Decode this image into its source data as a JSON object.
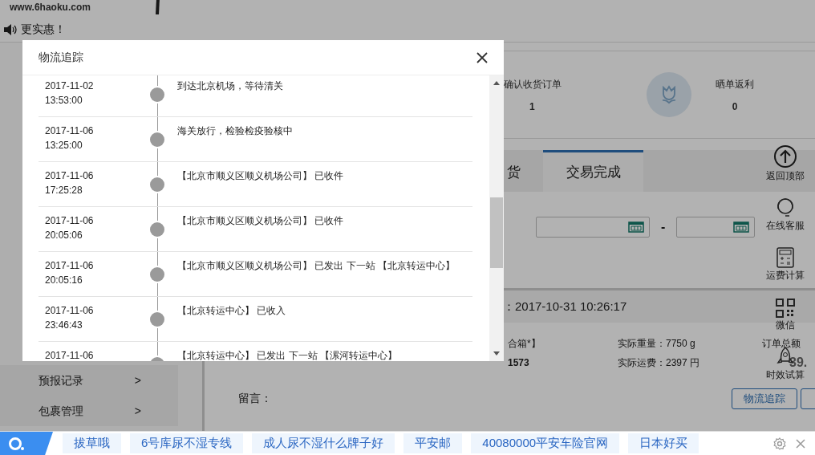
{
  "site": {
    "logo": "www.6haoku.com"
  },
  "notice": {
    "text": "更实惠！"
  },
  "sidebar": {
    "items": [
      {
        "label": "预报记录",
        "arrow": ">"
      },
      {
        "label": "包裹管理",
        "arrow": ">"
      }
    ]
  },
  "stats": [
    {
      "label": "确认收货订单",
      "value": "1"
    },
    {
      "label": "晒单返利",
      "value": "0"
    }
  ],
  "tabs": [
    {
      "label": "货",
      "selected": false
    },
    {
      "label": "交易完成",
      "selected": true
    }
  ],
  "filter": {
    "separator": "-"
  },
  "order": {
    "time": "：2017-10-31 10:26:17",
    "box_note": "合箱*】",
    "weight": "实际重量：7750 g",
    "tracking_fragment": "1573",
    "freight": "实际运费：2397 円",
    "total_label": "订单总额",
    "total_fragment": "39.",
    "message_label": "留言：",
    "buttons": [
      "物流追踪"
    ]
  },
  "float_tools": [
    {
      "kind": "top",
      "label": "返回顶部"
    },
    {
      "kind": "service",
      "label": "在线客服"
    },
    {
      "kind": "calc",
      "label": "运费计算"
    },
    {
      "kind": "qr",
      "label": "微信"
    },
    {
      "kind": "rocket",
      "label": "时效试算"
    }
  ],
  "modal": {
    "title": "物流追踪",
    "events": [
      {
        "date": "2017-11-02",
        "time": "13:53:00",
        "text": "到达北京机场，等待清关"
      },
      {
        "date": "2017-11-06",
        "time": "13:25:00",
        "text": "海关放行，检验检疫验核中"
      },
      {
        "date": "2017-11-06",
        "time": "17:25:28",
        "text": "【北京市顺义区顺义机场公司】 已收件"
      },
      {
        "date": "2017-11-06",
        "time": "20:05:06",
        "text": "【北京市顺义区顺义机场公司】 已收件"
      },
      {
        "date": "2017-11-06",
        "time": "20:05:16",
        "text": "【北京市顺义区顺义机场公司】 已发出 下一站 【北京转运中心】"
      },
      {
        "date": "2017-11-06",
        "time": "23:46:43",
        "text": "【北京转运中心】 已收入"
      },
      {
        "date": "2017-11-06",
        "text": "【北京转运中心】 已发出 下一站 【漯河转运中心】"
      }
    ]
  },
  "bottom_bar": {
    "chips": [
      "拔草哦",
      "6号库尿不湿专线",
      "成人尿不湿什么牌子好",
      "平安邮",
      "40080000平安车险官网",
      "日本好买"
    ]
  }
}
